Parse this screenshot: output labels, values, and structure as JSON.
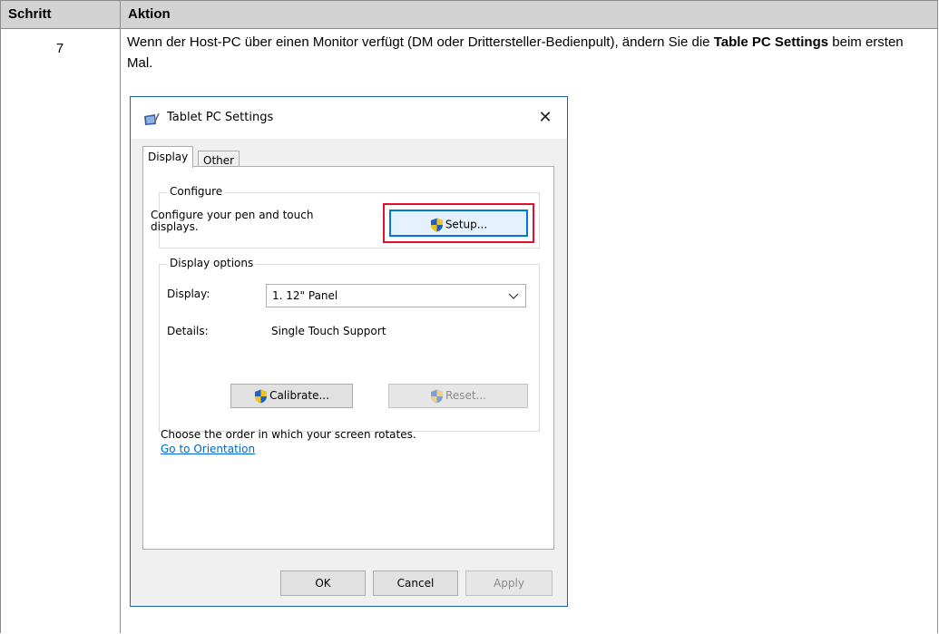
{
  "table": {
    "header_step": "Schritt",
    "header_action": "Aktion",
    "rows": [
      {
        "step": "7",
        "text_part1": "Wenn der Host-PC über einen Monitor verfügt (DM oder Drittersteller-Bedienpult), ändern Sie die ",
        "text_bold": "Table PC Settings",
        "text_part2": " beim ersten Mal."
      }
    ]
  },
  "dialog": {
    "title": "Tablet PC Settings",
    "close_label": "✕",
    "tabs": [
      {
        "label": "Display",
        "active": true
      },
      {
        "label": "Other",
        "active": false
      }
    ],
    "configure": {
      "group_title": "Configure",
      "description": "Configure your pen and touch displays.",
      "setup_button": "Setup..."
    },
    "display_options": {
      "group_title": "Display options",
      "display_label": "Display:",
      "display_value": "1. 12\" Panel",
      "details_label": "Details:",
      "details_value": "Single Touch Support",
      "calibrate_button": "Calibrate...",
      "reset_button": "Reset..."
    },
    "orientation": {
      "text": "Choose the order in which your screen rotates.",
      "link": "Go to Orientation"
    },
    "footer": {
      "ok": "OK",
      "cancel": "Cancel",
      "apply": "Apply"
    }
  },
  "colors": {
    "highlight_box": "#e0102e",
    "link": "#0066cc",
    "dialog_border": "#1c62b9"
  }
}
